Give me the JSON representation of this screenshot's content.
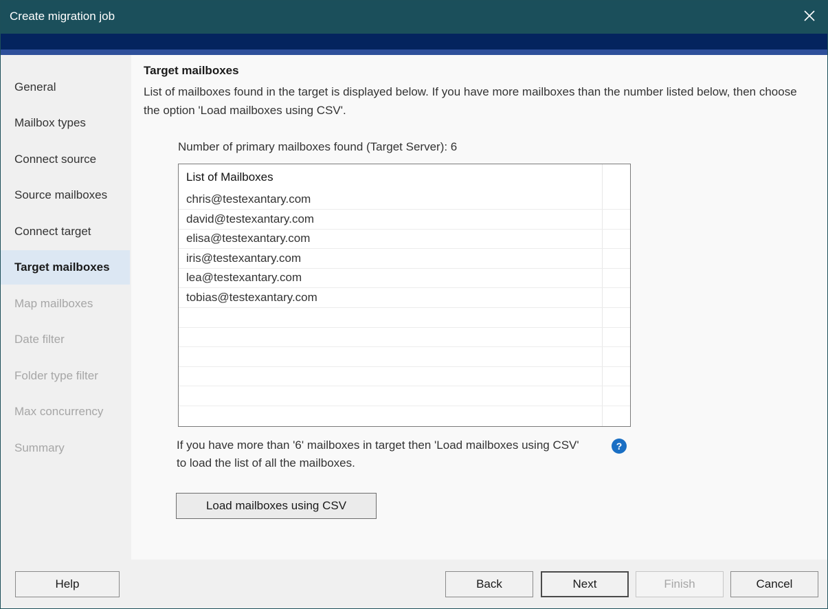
{
  "window": {
    "title": "Create migration job"
  },
  "sidebar": {
    "items": [
      {
        "label": "General",
        "state": "normal"
      },
      {
        "label": "Mailbox types",
        "state": "normal"
      },
      {
        "label": "Connect source",
        "state": "normal"
      },
      {
        "label": "Source mailboxes",
        "state": "normal"
      },
      {
        "label": "Connect target",
        "state": "normal"
      },
      {
        "label": "Target mailboxes",
        "state": "active"
      },
      {
        "label": "Map mailboxes",
        "state": "disabled"
      },
      {
        "label": "Date filter",
        "state": "disabled"
      },
      {
        "label": "Folder type filter",
        "state": "disabled"
      },
      {
        "label": "Max concurrency",
        "state": "disabled"
      },
      {
        "label": "Summary",
        "state": "disabled"
      }
    ]
  },
  "main": {
    "heading": "Target mailboxes",
    "description": "List of mailboxes found in the target is displayed below. If you have more mailboxes than the number listed below, then choose the option 'Load mailboxes using CSV'.",
    "count_line": "Number of primary mailboxes found (Target Server): 6",
    "list": {
      "header": "List of Mailboxes",
      "rows": [
        "chris@testexantary.com",
        "david@testexantary.com",
        "elisa@testexantary.com",
        "iris@testexantary.com",
        "lea@testexantary.com",
        "tobias@testexantary.com"
      ]
    },
    "note": "If you have more than '6' mailboxes in target then 'Load mailboxes using CSV' to load the list of all the mailboxes.",
    "help_icon_glyph": "?",
    "load_button": "Load mailboxes using CSV"
  },
  "footer": {
    "help": "Help",
    "back": "Back",
    "next": "Next",
    "finish": "Finish",
    "cancel": "Cancel"
  },
  "colors": {
    "titlebar": "#1b4f5b",
    "band": "#04245e",
    "active_nav": "#dce7f3",
    "help_icon": "#1a6fc4"
  },
  "icons": {
    "close": "close-icon",
    "help": "help-icon"
  }
}
